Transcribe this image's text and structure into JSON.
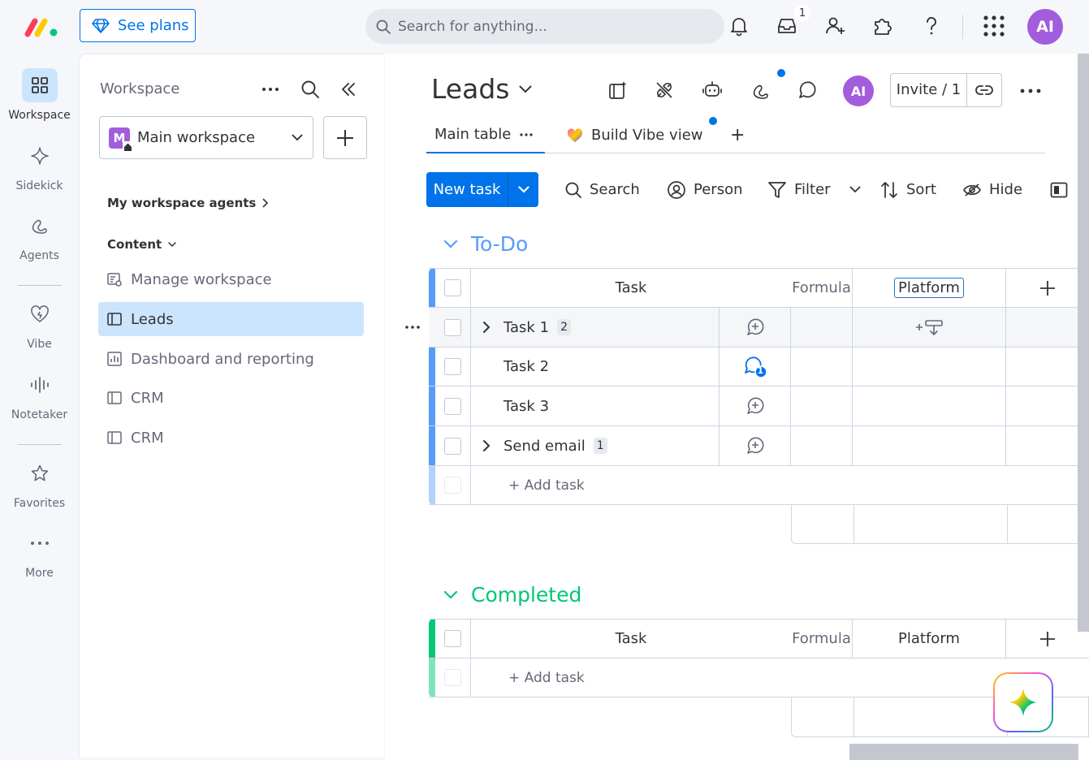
{
  "topbar": {
    "see_plans": "See plans",
    "search_placeholder": "Search for anything...",
    "inbox_count": "1",
    "avatar": "AI"
  },
  "rail": {
    "items": [
      {
        "label": "Workspace",
        "icon": "grid-icon"
      },
      {
        "label": "Sidekick",
        "icon": "sparkle-icon"
      },
      {
        "label": "Agents",
        "icon": "agents-icon"
      },
      {
        "label": "Vibe",
        "icon": "heart-icon"
      },
      {
        "label": "Notetaker",
        "icon": "waveform-icon"
      },
      {
        "label": "Favorites",
        "icon": "star-icon"
      },
      {
        "label": "More",
        "icon": "dots-icon"
      }
    ]
  },
  "workspace": {
    "title": "Workspace",
    "selected": "Main workspace",
    "badge": "M",
    "agents_section": "My workspace agents",
    "content_section": "Content",
    "items": [
      {
        "label": "Manage workspace"
      },
      {
        "label": "Leads"
      },
      {
        "label": "Dashboard and reporting"
      },
      {
        "label": "CRM"
      },
      {
        "label": "CRM"
      }
    ]
  },
  "board": {
    "title": "Leads",
    "avatar": "AI",
    "invite": "Invite / 1",
    "tabs": [
      {
        "label": "Main table"
      },
      {
        "label": "Build Vibe view"
      }
    ],
    "add_tab": "+",
    "toolbar": {
      "new_task": "New task",
      "search": "Search",
      "person": "Person",
      "filter": "Filter",
      "sort": "Sort",
      "hide": "Hide"
    },
    "columns": {
      "task": "Task",
      "formula": "Formula",
      "platform": "Platform"
    },
    "groups": [
      {
        "name": "To-Do",
        "color": "#579bfc",
        "rows": [
          {
            "name": "Task 1",
            "subitems": "2"
          },
          {
            "name": "Task 2",
            "updates": "1"
          },
          {
            "name": "Task 3"
          },
          {
            "name": "Send email",
            "subitems": "1"
          }
        ],
        "add_label": "+ Add task"
      },
      {
        "name": "Completed",
        "color": "#00c875",
        "rows": [],
        "add_label": "+ Add task"
      }
    ]
  },
  "colors": {
    "primary": "#0073ea",
    "todo": "#579bfc",
    "completed": "#00c875",
    "avatar": "#a25ddc"
  }
}
